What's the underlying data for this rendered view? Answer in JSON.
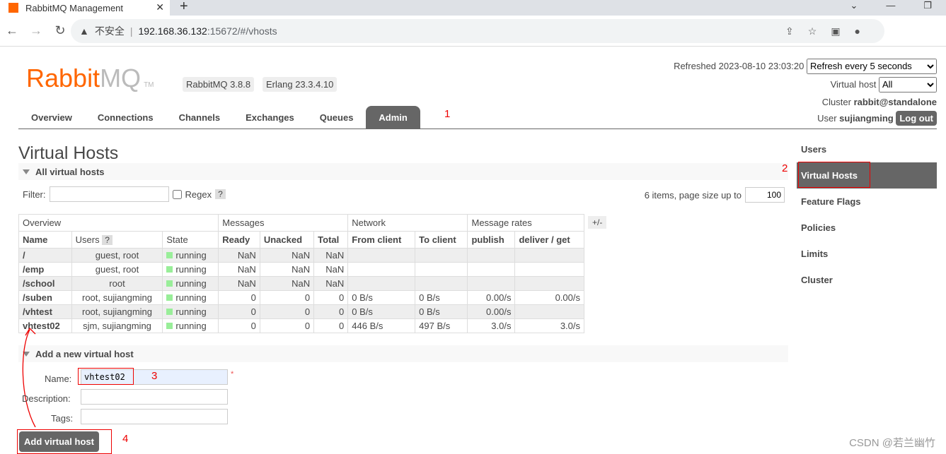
{
  "browser": {
    "tab_title": "RabbitMQ Management",
    "url_warning": "不安全",
    "url_host": "192.168.36.132",
    "url_rest": ":15672/#/vhosts"
  },
  "header": {
    "logo_rabbit": "Rabbit",
    "logo_mq": "MQ",
    "logo_tm": "TM",
    "version": "RabbitMQ 3.8.8",
    "erlang": "Erlang 23.3.4.10",
    "refreshed": "Refreshed 2023-08-10 23:03:20",
    "refresh_option": "Refresh every 5 seconds",
    "vhost_label": "Virtual host",
    "vhost_option": "All",
    "cluster_label": "Cluster",
    "cluster": "rabbit@standalone",
    "user_label": "User",
    "user": "sujiangming",
    "logout": "Log out"
  },
  "tabs": [
    "Overview",
    "Connections",
    "Channels",
    "Exchanges",
    "Queues",
    "Admin"
  ],
  "annotations": [
    "1",
    "2",
    "3",
    "4"
  ],
  "sidebar": [
    "Users",
    "Virtual Hosts",
    "Feature Flags",
    "Policies",
    "Limits",
    "Cluster"
  ],
  "page_title": "Virtual Hosts",
  "all_section": "All virtual hosts",
  "filter": {
    "label": "Filter:",
    "regex": "Regex",
    "help": "?",
    "items": "6 items, page size up to",
    "page_size": "100"
  },
  "table": {
    "groups": [
      "Overview",
      "Messages",
      "Network",
      "Message rates"
    ],
    "plusminus": "+/-",
    "headers": [
      "Name",
      "Users",
      "State",
      "Ready",
      "Unacked",
      "Total",
      "From client",
      "To client",
      "publish",
      "deliver / get"
    ],
    "rows": [
      [
        "/",
        "guest, root",
        "running",
        "NaN",
        "NaN",
        "NaN",
        "",
        "",
        "",
        ""
      ],
      [
        "/emp",
        "guest, root",
        "running",
        "NaN",
        "NaN",
        "NaN",
        "",
        "",
        "",
        ""
      ],
      [
        "/school",
        "root",
        "running",
        "NaN",
        "NaN",
        "NaN",
        "",
        "",
        "",
        ""
      ],
      [
        "/suben",
        "root, sujiangming",
        "running",
        "0",
        "0",
        "0",
        "0 B/s",
        "0 B/s",
        "0.00/s",
        "0.00/s"
      ],
      [
        "/vhtest",
        "root, sujiangming",
        "running",
        "0",
        "0",
        "0",
        "0 B/s",
        "0 B/s",
        "0.00/s",
        ""
      ],
      [
        "vhtest02",
        "sjm, sujiangming",
        "running",
        "0",
        "0",
        "0",
        "446 B/s",
        "497 B/s",
        "3.0/s",
        "3.0/s"
      ]
    ]
  },
  "add": {
    "section": "Add a new virtual host",
    "name_label": "Name:",
    "name_value": "vhtest02",
    "required": "*",
    "desc_label": "Description:",
    "tags_label": "Tags:",
    "button": "Add virtual host"
  },
  "watermark": "CSDN @若兰幽竹"
}
